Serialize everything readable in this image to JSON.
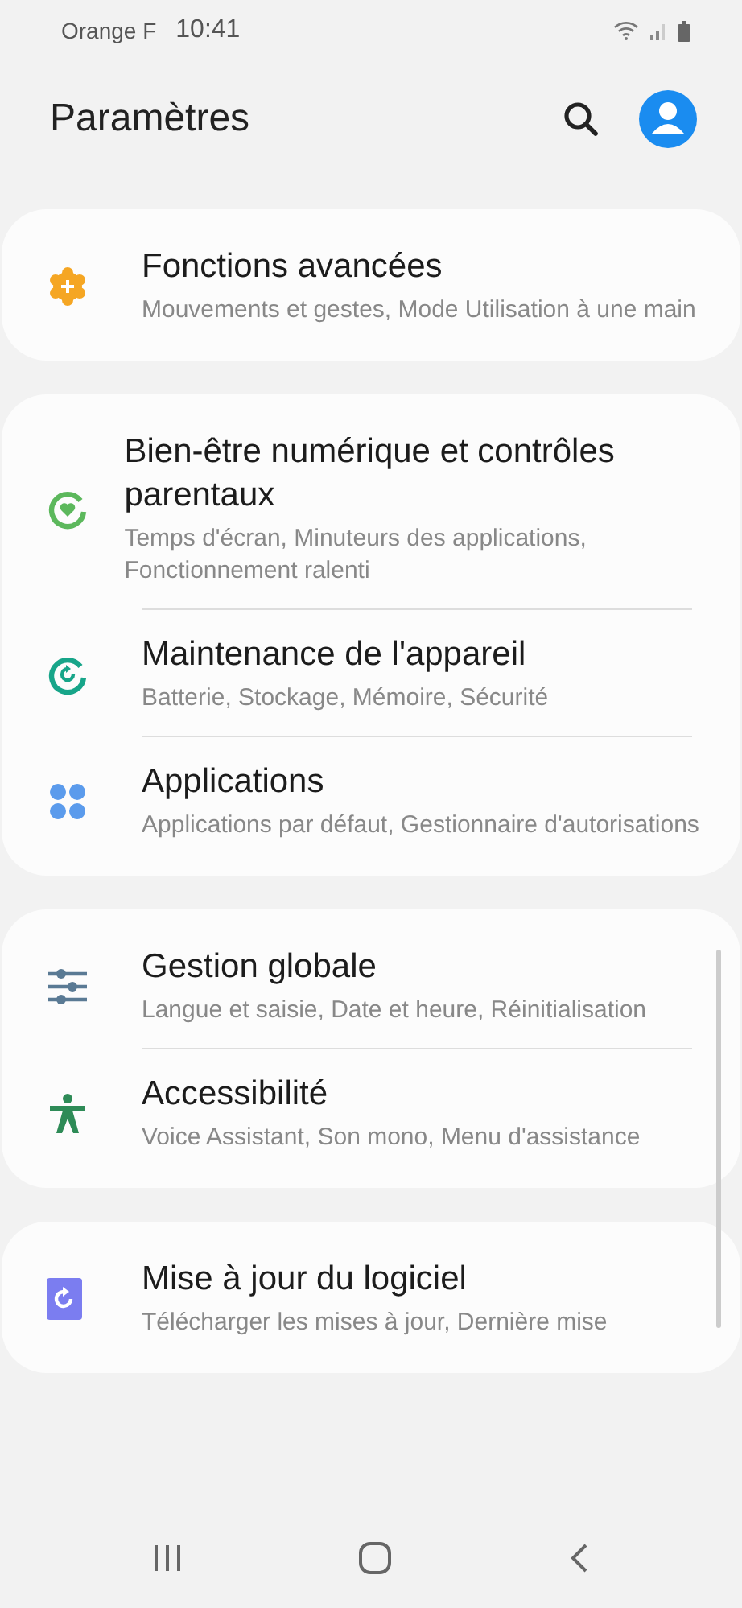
{
  "status_bar": {
    "carrier": "Orange F",
    "time": "10:41"
  },
  "header": {
    "title": "Paramètres"
  },
  "groups": [
    {
      "items": [
        {
          "title": "Fonctions avancées",
          "subtitle": "Mouvements et gestes, Mode Utilisation à une main"
        }
      ]
    },
    {
      "items": [
        {
          "title": "Bien-être numérique et contrôles parentaux",
          "subtitle": "Temps d'écran, Minuteurs des applications, Fonctionnement ralenti"
        },
        {
          "title": "Maintenance de l'appareil",
          "subtitle": "Batterie, Stockage, Mémoire, Sécurité"
        },
        {
          "title": "Applications",
          "subtitle": "Applications par défaut, Gestionnaire d'autorisations"
        }
      ]
    },
    {
      "items": [
        {
          "title": "Gestion globale",
          "subtitle": "Langue et saisie, Date et heure, Réinitialisation"
        },
        {
          "title": "Accessibilité",
          "subtitle": "Voice Assistant, Son mono, Menu d'assistance"
        }
      ]
    },
    {
      "items": [
        {
          "title": "Mise à jour du logiciel",
          "subtitle": "Télécharger les mises à jour, Dernière mise"
        }
      ]
    }
  ]
}
